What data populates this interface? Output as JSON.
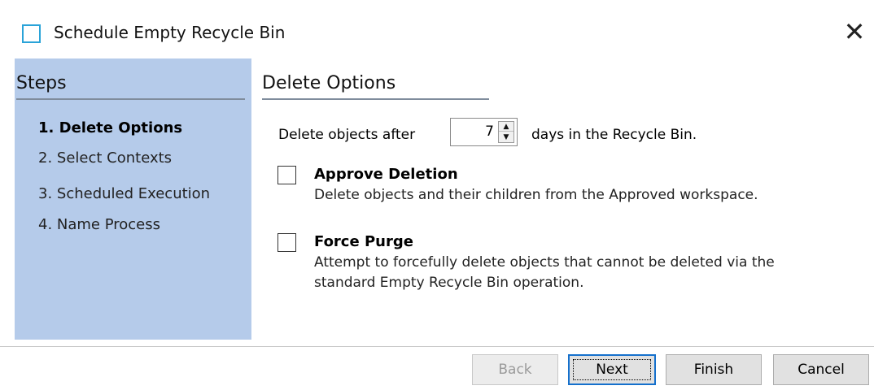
{
  "window": {
    "title": "Schedule Empty Recycle Bin",
    "close_glyph": "✕"
  },
  "steps": {
    "header": "Steps",
    "items": [
      {
        "label": "1. Delete Options",
        "active": true
      },
      {
        "label": "2. Select Contexts",
        "active": false
      },
      {
        "label": "3. Scheduled Execution",
        "active": false
      },
      {
        "label": "4. Name Process",
        "active": false
      }
    ]
  },
  "content": {
    "header": "Delete Options",
    "days_label": "Delete objects after",
    "days_value": "7",
    "days_suffix": "days in the Recycle Bin.",
    "approve": {
      "title": "Approve Deletion",
      "desc": "Delete objects and their children from the Approved workspace.",
      "checked": false
    },
    "purge": {
      "title": "Force Purge",
      "desc_line1": "Attempt to forcefully delete objects that cannot be deleted via the",
      "desc_line2": "standard Empty Recycle Bin operation.",
      "checked": false
    }
  },
  "buttons": {
    "back": "Back",
    "next": "Next",
    "finish": "Finish",
    "cancel": "Cancel"
  },
  "colors": {
    "steps_panel": "#b5cbea",
    "default_button_border": "#1570cc",
    "app_icon": "#2aa3d8"
  }
}
